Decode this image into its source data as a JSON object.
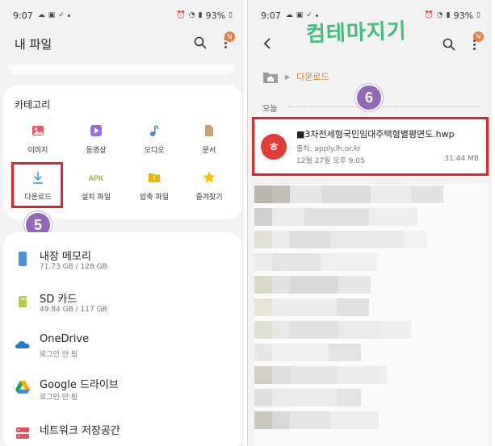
{
  "left": {
    "status": {
      "time": "9:07",
      "battery": "93%"
    },
    "title": "내 파일",
    "badge": "N",
    "categories_title": "카테고리",
    "categories": [
      {
        "label": "이미지",
        "icon": "image-icon",
        "color": "#e85a6a"
      },
      {
        "label": "동영상",
        "icon": "video-icon",
        "color": "#9b6ed6"
      },
      {
        "label": "오디오",
        "icon": "audio-icon",
        "color": "#4a7fd6"
      },
      {
        "label": "문서",
        "icon": "document-icon",
        "color": "#c9a27a"
      },
      {
        "label": "다운로드",
        "icon": "download-icon",
        "color": "#3aa3d6"
      },
      {
        "label": "설치 파일",
        "icon": "apk-icon",
        "color": "#7cc22e"
      },
      {
        "label": "압축 파일",
        "icon": "archive-icon",
        "color": "#f0b400"
      },
      {
        "label": "즐겨찾기",
        "icon": "star-icon",
        "color": "#f5c400"
      }
    ],
    "step": "5",
    "storage": [
      {
        "name": "내장 메모리",
        "sub": "71.73 GB / 128 GB",
        "icon": "phone-icon",
        "color": "#4a8fe0"
      },
      {
        "name": "SD 카드",
        "sub": "49.84 GB / 117 GB",
        "icon": "sd-card-icon",
        "color": "#b5c94a"
      },
      {
        "name": "OneDrive",
        "sub": "로그인 안 됨",
        "icon": "onedrive-icon",
        "color": "#1e78d6"
      },
      {
        "name": "Google 드라이브",
        "sub": "로그인 안 됨",
        "icon": "google-drive-icon",
        "color": "#1fa463"
      },
      {
        "name": "네트워크 저장공간",
        "sub": "",
        "icon": "network-storage-icon",
        "color": "#e0525f"
      }
    ]
  },
  "right": {
    "status": {
      "time": "9:07",
      "battery": "93%"
    },
    "watermark": "컴테마지기",
    "badge": "N",
    "breadcrumb": {
      "current": "다운로드"
    },
    "section": "오늘",
    "step": "6",
    "file": {
      "name": "■3차전세형국민임대주택형별평면도.hwp",
      "source": "출처: apply.lh.or.kr",
      "date": "12월 27일 오후 9:05",
      "size": "31.44 MB",
      "icon_letter": "ㅎ"
    }
  }
}
